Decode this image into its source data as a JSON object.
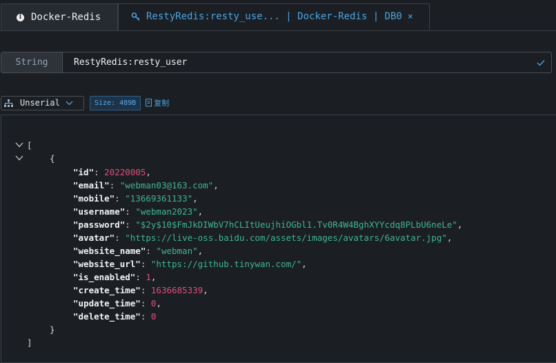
{
  "tabs": [
    {
      "label": "Docker-Redis",
      "icon": "info-icon"
    },
    {
      "label": "RestyRedis:resty_use... | Docker-Redis | DB0",
      "icon": "key-icon",
      "close": "×"
    }
  ],
  "key": {
    "type": "String",
    "name": "RestyRedis:resty_user"
  },
  "toolbar": {
    "format": "Unserial·",
    "size": "Size: 489B",
    "copy": "复制"
  },
  "json": {
    "open_bracket": "[",
    "open_brace": "{",
    "close_brace": "}",
    "close_bracket": "]",
    "fields": [
      {
        "key": "\"id\"",
        "value": "20220005",
        "kind": "number"
      },
      {
        "key": "\"email\"",
        "value": "\"webman03@163.com\"",
        "kind": "string"
      },
      {
        "key": "\"mobile\"",
        "value": "\"13669361133\"",
        "kind": "string"
      },
      {
        "key": "\"username\"",
        "value": "\"webman2023\"",
        "kind": "string"
      },
      {
        "key": "\"password\"",
        "value": "\"$2y$10$FmJkDIWbV7hCLItUeujhiOGbl1.Tv0R4W4BghXYYcdq8PLbU6neLe\"",
        "kind": "string"
      },
      {
        "key": "\"avatar\"",
        "value": "\"https://live-oss.baidu.com/assets/images/avatars/6avatar.jpg\"",
        "kind": "string"
      },
      {
        "key": "\"website_name\"",
        "value": "\"webman\"",
        "kind": "string"
      },
      {
        "key": "\"website_url\"",
        "value": "\"https://github.tinywan.com/\"",
        "kind": "string"
      },
      {
        "key": "\"is_enabled\"",
        "value": "1",
        "kind": "number"
      },
      {
        "key": "\"create_time\"",
        "value": "1636685339",
        "kind": "number"
      },
      {
        "key": "\"update_time\"",
        "value": "0",
        "kind": "number"
      },
      {
        "key": "\"delete_time\"",
        "value": "0",
        "kind": "number"
      }
    ]
  },
  "colors": {
    "accent": "#4aa3e0",
    "string": "#3fb58e",
    "number": "#e24f78",
    "background": "#1b1f24"
  }
}
